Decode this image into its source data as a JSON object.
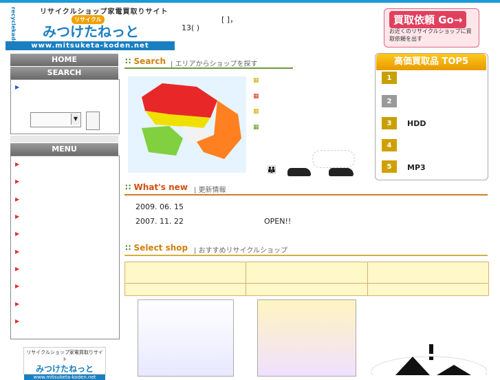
{
  "header": {
    "logo_tagline": "リサイクルショップ家電買取りサイト",
    "logo_badge": "リサイクル",
    "logo_main": "みつけたねっと",
    "logo_url": "www.mitsuketa-koden.net",
    "logo_side": "recyclekaden",
    "bracket_text": "[        ]，",
    "count_text": "13(          )",
    "request_button_title": "買取依頼 Go→",
    "request_button_sub": "お近くのリサイクルショップに買取依頼を出す"
  },
  "sidebar": {
    "home_label": "HOME",
    "search_label": "SEARCH",
    "menu_label": "MENU",
    "menu_items": [
      "",
      "",
      "",
      "",
      "",
      "",
      "",
      "",
      "",
      ""
    ]
  },
  "search_section": {
    "title": "Search",
    "subtitle": "エリアからショップを探す"
  },
  "ranking": {
    "title": "高価買取品 TOP5",
    "items": [
      {
        "rank": "1",
        "label": ""
      },
      {
        "rank": "2",
        "label": ""
      },
      {
        "rank": "3",
        "label": "HDD"
      },
      {
        "rank": "4",
        "label": ""
      },
      {
        "rank": "5",
        "label": "MP3"
      }
    ]
  },
  "news_section": {
    "title": "What's new",
    "subtitle": "更新情報",
    "items": [
      {
        "date": "2009. 06. 15",
        "text": ""
      },
      {
        "date": "2007. 11. 22",
        "text": "OPEN!!"
      }
    ]
  },
  "shop_section": {
    "title": "Select shop",
    "subtitle": "おすすめリサイクルショップ"
  },
  "colors": {
    "accent": "#1a9ad6",
    "orange": "#d08010",
    "green": "#5a8a2a",
    "red": "#e03030"
  }
}
